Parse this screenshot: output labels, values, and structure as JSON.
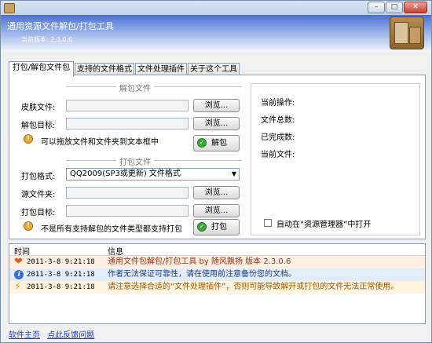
{
  "window": {
    "title_buttons": {
      "minimize": "–",
      "maximize": "□",
      "close": "✕"
    }
  },
  "header": {
    "title": "通用资源文件解包/打包工具",
    "version": "当前版本: 2.3.0.6"
  },
  "tabs": [
    {
      "label": "打包/解包文件包"
    },
    {
      "label": "支持的文件格式"
    },
    {
      "label": "文件处理插件"
    },
    {
      "label": "关于这个工具"
    }
  ],
  "unpack": {
    "section_title": "解包文件",
    "skin_file_label": "皮肤文件:",
    "target_label": "解包目标:",
    "browse_label": "浏览...",
    "hint": "可以拖放文件和文件夹到文本框中",
    "action_label": "解包"
  },
  "pack": {
    "section_title": "打包文件",
    "format_label": "打包格式:",
    "format_value": "QQ2009(SP3或更新) 文件格式",
    "source_label": "源文件夹:",
    "target_label": "打包目标:",
    "browse_label": "浏览...",
    "hint": "不是所有支持解包的文件类型都支持打包",
    "action_label": "打包"
  },
  "status": {
    "current_op": "当前操作:",
    "total_files": "文件总数:",
    "done_count": "已完成数:",
    "current_file": "当前文件:",
    "open_in_explorer": "自动在“资源管理器”中打开"
  },
  "log": {
    "col_time": "时间",
    "col_info": "信息",
    "rows": [
      {
        "icon": "heart-icon",
        "time": "2011-3-8 9:21:18",
        "message": "通用文件包解包/打包工具 by 随风飘扬 版本 2.3.0.6",
        "color": "#a03010"
      },
      {
        "icon": "info-icon",
        "time": "2011-3-8 9:21:18",
        "message": "作者无法保证可靠性，请在使用前注意备份您的文档。",
        "color": "#1a3c8c"
      },
      {
        "icon": "lightning-icon",
        "time": "2011-3-8 9:21:18",
        "message": "请注意选择合适的“文件处理插件”，否则可能导致解开或打包的文件无法正常使用。",
        "color": "#9a5a00"
      }
    ]
  },
  "links": {
    "home": "软件主页",
    "feedback": "点此反馈问题"
  },
  "colors": {
    "log_row_1_bg": "#fdeee2",
    "log_row_2_bg": "#e3edf9",
    "log_row_3_bg": "#fdf3df",
    "link": "#1a39c6"
  }
}
